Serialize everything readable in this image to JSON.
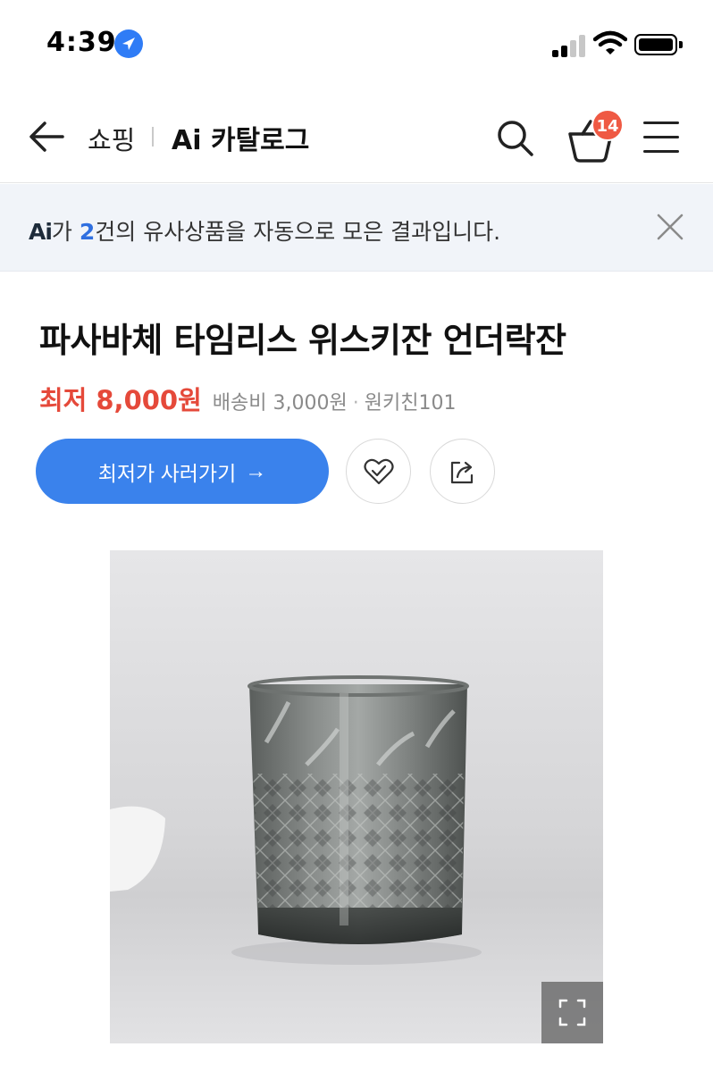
{
  "status_bar": {
    "time": "4:39"
  },
  "header": {
    "category": "쇼핑",
    "title": "Ai 카탈로그",
    "cart_count": "14"
  },
  "notice": {
    "ai_label": "Ai",
    "prefix": "가",
    "count": "2",
    "suffix": "건의 유사상품을 자동으로 모은 결과입니다."
  },
  "product": {
    "title": "파사바체 타임리스 위스키잔 언더락잔",
    "price_label": "최저",
    "price_value": "8,000원",
    "shipping": "배송비 3,000원",
    "seller": "원키친101",
    "buy_label": "최저가 사러가기",
    "buy_arrow": "→"
  },
  "colors": {
    "accent_blue": "#3a82ec",
    "price_red": "#e5493a",
    "badge_red": "#ef5943",
    "notice_bg": "#f1f4f9"
  },
  "icons": {
    "back": "arrow-left-icon",
    "search": "search-icon",
    "cart": "cart-icon",
    "menu": "hamburger-menu-icon",
    "close": "close-icon",
    "like": "heart-check-icon",
    "share": "share-icon",
    "expand": "expand-icon"
  }
}
